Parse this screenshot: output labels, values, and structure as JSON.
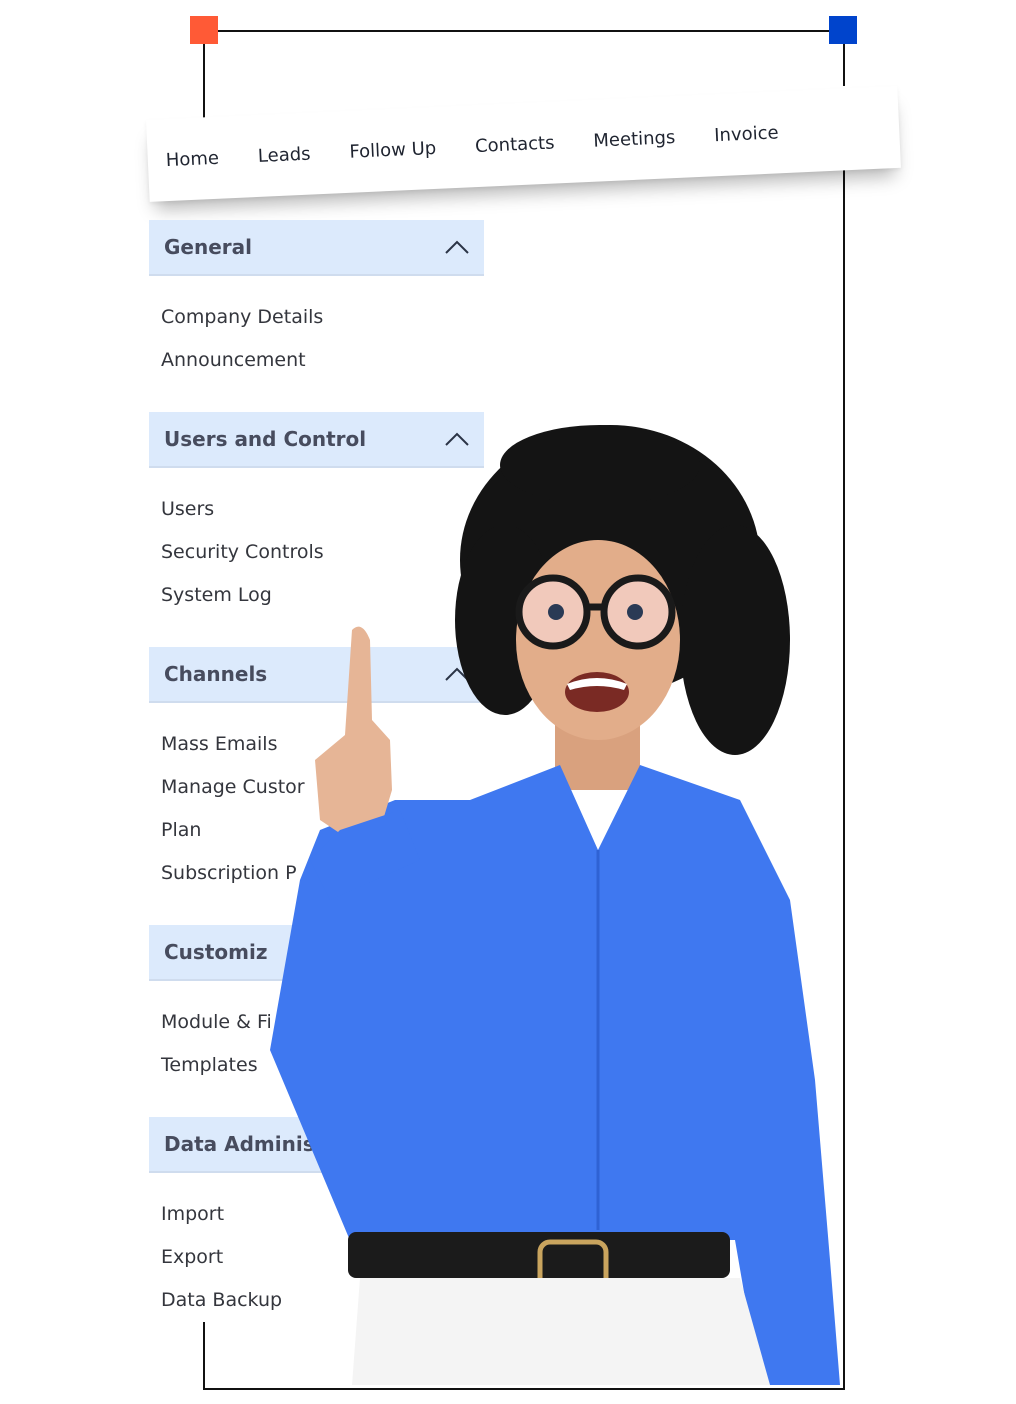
{
  "nav": {
    "items": [
      "Home",
      "Leads",
      "Follow Up",
      "Contacts",
      "Meetings",
      "Invoice"
    ]
  },
  "sidebar": {
    "sections": [
      {
        "title": "General",
        "expanded": true,
        "items": [
          "Company Details",
          "Announcement"
        ]
      },
      {
        "title": "Users and Control",
        "expanded": true,
        "items": [
          "Users",
          "Security Controls",
          "System Log"
        ]
      },
      {
        "title": "Channels",
        "expanded": true,
        "items": [
          "Mass Emails",
          "Manage Custor",
          "Plan",
          "Subscription P"
        ]
      },
      {
        "title": "Customiz",
        "expanded": true,
        "items": [
          "Module & Fi",
          "Templates"
        ]
      },
      {
        "title": "Data Administra",
        "expanded": true,
        "items": [
          "Import",
          "Export",
          "Data Backup"
        ]
      }
    ]
  },
  "colors": {
    "corner_left": "#ff5a36",
    "corner_right": "#0044cc",
    "section_bg": "#dceafc",
    "shirt": "#3f78f0"
  },
  "icons": {
    "section_toggle": "chevron-up-icon"
  }
}
